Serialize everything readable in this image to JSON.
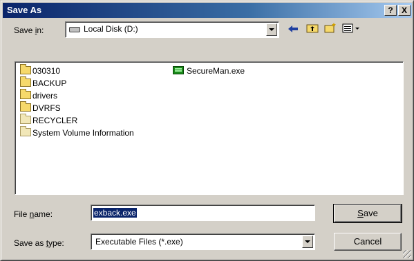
{
  "window": {
    "title": "Save As",
    "help_label": "?",
    "close_label": "X"
  },
  "save_in": {
    "label_pre": "Save ",
    "label_accel": "i",
    "label_post": "n:",
    "value": "Local Disk (D:)",
    "icon": "drive-icon"
  },
  "toolbar": {
    "back_icon": "back-arrow-icon",
    "up_icon": "up-folder-icon",
    "new_folder_icon": "new-folder-icon",
    "views_icon": "views-menu-icon"
  },
  "files": [
    {
      "name": "030310",
      "type": "folder"
    },
    {
      "name": "BACKUP",
      "type": "folder"
    },
    {
      "name": "drivers",
      "type": "folder"
    },
    {
      "name": "DVRFS",
      "type": "folder"
    },
    {
      "name": "RECYCLER",
      "type": "folder-system"
    },
    {
      "name": "System Volume Information",
      "type": "folder-system"
    },
    {
      "name": "SecureMan.exe",
      "type": "exe"
    }
  ],
  "file_name": {
    "label_pre": "File ",
    "label_accel": "n",
    "label_post": "ame:",
    "value": "exback.exe"
  },
  "save_type": {
    "label_pre": "Save as ",
    "label_accel": "t",
    "label_post": "ype:",
    "value": "Executable Files (*.exe)"
  },
  "buttons": {
    "save_accel": "S",
    "save_rest": "ave",
    "cancel": "Cancel"
  },
  "colors": {
    "title_start": "#0a246a",
    "title_end": "#a6caf0",
    "face": "#d4d0c8",
    "selection": "#0a246a"
  }
}
